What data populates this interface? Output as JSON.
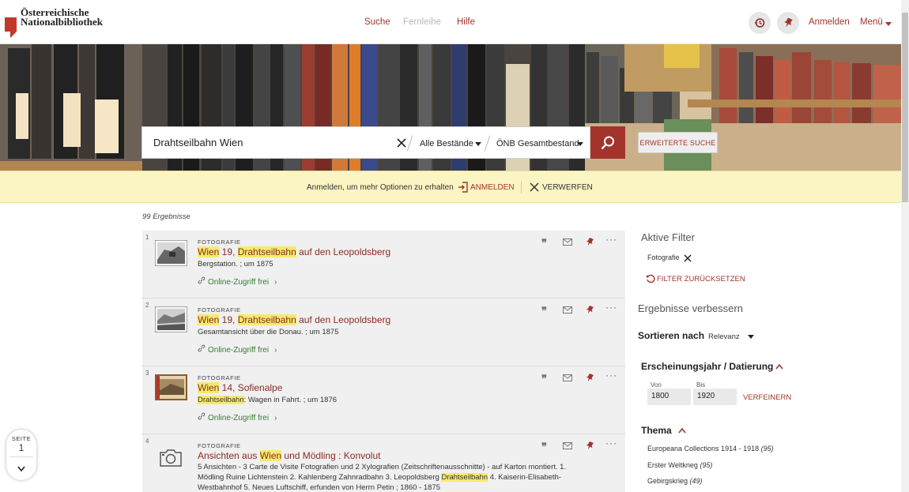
{
  "logo": {
    "line1": "Österreichische",
    "line2": "Nationalbibliothek"
  },
  "nav": {
    "search": "Suche",
    "ill": "Fernleihe",
    "help": "Hilfe"
  },
  "header": {
    "login": "Anmelden",
    "menu": "Menü"
  },
  "search": {
    "query": "Drahtseilbahn Wien",
    "scope": "Alle Bestände",
    "collection": "ÖNB Gesamtbestand",
    "advanced": "ERWEITERTE SUCHE"
  },
  "notice": {
    "message": "Anmelden, um mehr Optionen zu erhalten",
    "login": "ANMELDEN",
    "dismiss": "VERWERFEN"
  },
  "results_count": "99 Ergebnisse",
  "results": [
    {
      "num": "1",
      "category": "FOTOGRAFIE",
      "title_parts": [
        "Wien",
        " 19, ",
        "Drahtseilbahn",
        " auf den Leopoldsberg"
      ],
      "sub": "Bergstation. ; um 1875",
      "link": "Online-Zugriff frei"
    },
    {
      "num": "2",
      "category": "FOTOGRAFIE",
      "title_parts": [
        "Wien",
        " 19, ",
        "Drahtseilbahn",
        " auf den Leopoldsberg"
      ],
      "sub": "Gesamtansicht über die Donau. ; um 1875",
      "link": "Online-Zugriff frei"
    },
    {
      "num": "3",
      "category": "FOTOGRAFIE",
      "title_parts": [
        "Wien",
        " 14, Sofienalpe"
      ],
      "sub_parts": [
        "Drahtseilbahn",
        ": Wagen in Fahrt. ; um 1876"
      ],
      "link": "Online-Zugriff frei"
    },
    {
      "num": "4",
      "category": "FOTOGRAFIE",
      "title_parts": [
        "Ansichten aus ",
        "Wien",
        " und Mödling : Konvolut"
      ],
      "sub_line1": "5 Ansichten - 3 Carte de Visite Fotografien und 2 Xylografien (Zeitschriftenausschnitte) - auf Karton montiert. 1.",
      "sub_line2a": "Mödling Ruine Lichtenstein 2. Kahlenberg Zahnradbahn 3. Leopoldsberg ",
      "sub_line2b": "Drahtseilbahn",
      "sub_line2c": " 4. Kaiserin-Elisabeth-",
      "sub_line3": "Westbahnhof 5. Neues Luftschiff, erfunden von Herrn Petin ; 1860 - 1875"
    }
  ],
  "sidebar": {
    "active_filters": "Aktive Filter",
    "filter_chip": "Fotografie",
    "reset": "FILTER ZURÜCKSETZEN",
    "refine_title": "Ergebnisse verbessern",
    "sort_label": "Sortieren nach",
    "sort_value": "Relevanz",
    "year_title": "Erscheinungsjahr / Datierung",
    "from_label": "Von",
    "to_label": "Bis",
    "from_value": "1800",
    "to_value": "1920",
    "refine_btn": "VERFEINERN",
    "topic_title": "Thema",
    "topics": [
      {
        "name": "Europeana Collections 1914 - 1918",
        "count": "(95)"
      },
      {
        "name": "Erster Weltkrieg",
        "count": "(95)"
      },
      {
        "name": "Gebirgskrieg",
        "count": "(49)"
      }
    ]
  },
  "pager": {
    "label": "SEITE",
    "page": "1"
  },
  "colors": {
    "accent": "#a3342b",
    "notice_bg": "#fbf4c3",
    "highlight": "#f6ea6d",
    "link_green": "#3a7a35"
  }
}
